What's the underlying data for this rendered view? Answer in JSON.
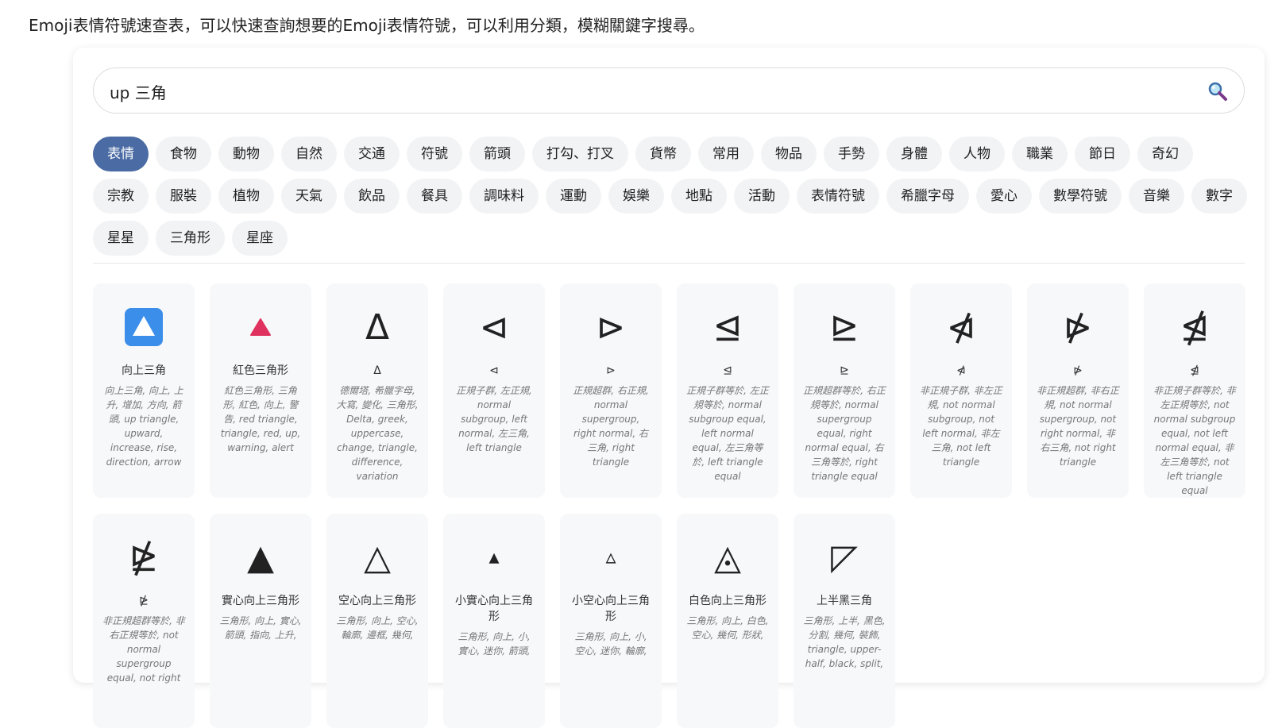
{
  "intro_text": "Emoji表情符號速查表，可以快速查詢想要的Emoji表情符號，可以利用分類，模糊關鍵字搜尋。",
  "search": {
    "value": "up 三角",
    "icon": "search-icon"
  },
  "categories": [
    {
      "label": "表情",
      "active": true
    },
    {
      "label": "食物"
    },
    {
      "label": "動物"
    },
    {
      "label": "自然"
    },
    {
      "label": "交通"
    },
    {
      "label": "符號"
    },
    {
      "label": "箭頭"
    },
    {
      "label": "打勾、打叉"
    },
    {
      "label": "貨幣"
    },
    {
      "label": "常用"
    },
    {
      "label": "物品"
    },
    {
      "label": "手勢"
    },
    {
      "label": "身體"
    },
    {
      "label": "人物"
    },
    {
      "label": "職業"
    },
    {
      "label": "節日"
    },
    {
      "label": "奇幻"
    },
    {
      "label": "宗教"
    },
    {
      "label": "服裝"
    },
    {
      "label": "植物"
    },
    {
      "label": "天氣"
    },
    {
      "label": "飲品"
    },
    {
      "label": "餐具"
    },
    {
      "label": "調味料"
    },
    {
      "label": "運動"
    },
    {
      "label": "娛樂"
    },
    {
      "label": "地點"
    },
    {
      "label": "活動"
    },
    {
      "label": "表情符號"
    },
    {
      "label": "希臘字母"
    },
    {
      "label": "愛心"
    },
    {
      "label": "數學符號"
    },
    {
      "label": "音樂"
    },
    {
      "label": "數字"
    },
    {
      "label": "星星"
    },
    {
      "label": "三角形"
    },
    {
      "label": "星座"
    }
  ],
  "results": [
    {
      "glyph_type": "blue-up-button",
      "name": "向上三角",
      "desc": "向上三角, 向上, 上升, 增加, 方向, 箭頭, up triangle, upward, increase, rise, direction, arrow",
      "accent": "#3b8eea"
    },
    {
      "glyph_type": "red-triangle",
      "name": "紅色三角形",
      "desc": "紅色三角形, 三角形, 紅色, 向上, 警告, red triangle, triangle, red, up, warning, alert",
      "accent": "#e0325e"
    },
    {
      "glyph_type": "text",
      "glyph": "Δ",
      "name": "Δ",
      "desc": "德爾塔, 希臘字母, 大寫, 變化, 三角形, Delta, greek, uppercase, change, triangle, difference, variation"
    },
    {
      "glyph_type": "text",
      "glyph": "⊲",
      "name": "⊲",
      "desc": "正規子群, 左正規, normal subgroup, left normal, 左三角, left triangle"
    },
    {
      "glyph_type": "text",
      "glyph": "⊳",
      "name": "⊳",
      "desc": "正規超群, 右正規, normal supergroup, right normal, 右三角, right triangle"
    },
    {
      "glyph_type": "text",
      "glyph": "⊴",
      "name": "⊴",
      "desc": "正規子群等於, 左正規等於, normal subgroup equal, left normal equal, 左三角等於, left triangle equal"
    },
    {
      "glyph_type": "text",
      "glyph": "⊵",
      "name": "⊵",
      "desc": "正規超群等於, 右正規等於, normal supergroup equal, right normal equal, 右三角等於, right triangle equal"
    },
    {
      "glyph_type": "text",
      "glyph": "⋪",
      "name": "⋪",
      "desc": "非正規子群, 非左正規, not normal subgroup, not left normal, 非左三角, not left triangle"
    },
    {
      "glyph_type": "text",
      "glyph": "⋫",
      "name": "⋫",
      "desc": "非正規超群, 非右正規, not normal supergroup, not right normal, 非右三角, not right triangle"
    },
    {
      "glyph_type": "text",
      "glyph": "⋬",
      "name": "⋬",
      "desc": "非正規子群等於, 非左正規等於, not normal subgroup equal, not left normal equal, 非左三角等於, not left triangle equal"
    },
    {
      "glyph_type": "text",
      "glyph": "⋭",
      "name": "⋭",
      "desc": "非正規超群等於, 非右正規等於, not normal supergroup equal, not right"
    },
    {
      "glyph_type": "text",
      "glyph": "▲",
      "name": "實心向上三角形",
      "desc": "三角形, 向上, 實心, 箭頭, 指向, 上升,"
    },
    {
      "glyph_type": "text",
      "glyph": "△",
      "name": "空心向上三角形",
      "desc": "三角形, 向上, 空心, 輪廓, 邊框, 幾何,"
    },
    {
      "glyph_type": "small",
      "glyph": "▴",
      "name": "小實心向上三角形",
      "desc": "三角形, 向上, 小, 實心, 迷你, 箭頭,"
    },
    {
      "glyph_type": "small",
      "glyph": "▵",
      "name": "小空心向上三角形",
      "desc": "三角形, 向上, 小, 空心, 迷你, 輪廓,"
    },
    {
      "glyph_type": "text",
      "glyph": "◬",
      "name": "白色向上三角形",
      "desc": "三角形, 向上, 白色, 空心, 幾何, 形狀,"
    },
    {
      "glyph_type": "text",
      "glyph": "◸",
      "name": "上半黑三角",
      "desc": "三角形, 上半, 黑色, 分割, 幾何, 裝飾, triangle, upper-half, black, split,"
    }
  ]
}
